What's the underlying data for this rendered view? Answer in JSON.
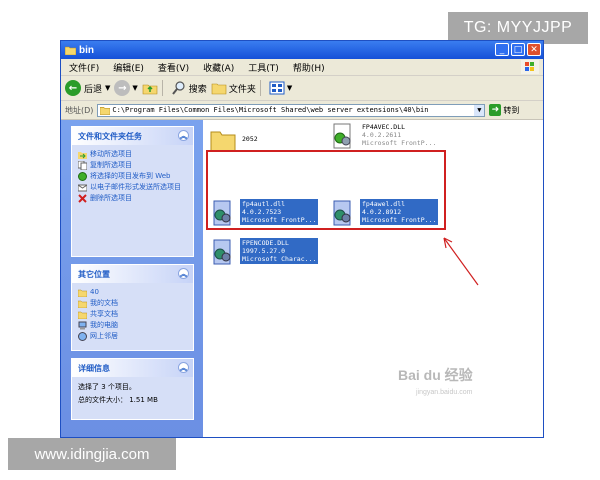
{
  "watermark_top": "TG: MYYJJPP",
  "watermark_bottom": "www.idingjia.com",
  "window": {
    "title": "bin",
    "menu": [
      "文件(F)",
      "编辑(E)",
      "查看(V)",
      "收藏(A)",
      "工具(T)",
      "帮助(H)"
    ],
    "toolbar": {
      "back": "后退",
      "search": "搜索",
      "folders": "文件夹"
    },
    "address": {
      "label": "地址(D)",
      "path": "C:\\Program Files\\Common Files\\Microsoft Shared\\web server extensions\\40\\bin",
      "go": "转到"
    }
  },
  "left_panel": {
    "tasks": {
      "header": "文件和文件夹任务",
      "items": [
        "移动所选项目",
        "复制所选项目",
        "将选择的项目发布到 Web",
        "以电子邮件形式发送所选项目",
        "删除所选项目"
      ]
    },
    "places": {
      "header": "其它位置",
      "items": [
        "40",
        "我的文档",
        "共享文档",
        "我的电脑",
        "网上邻居"
      ]
    },
    "details": {
      "header": "详细信息",
      "line1": "选择了 3 个项目。",
      "line2": "总的文件大小： 1.51 MB"
    }
  },
  "files": [
    {
      "name": "2052",
      "type": "folder",
      "selected": false
    },
    {
      "name": "FP4AVEC.DLL",
      "version": "4.0.2.2611",
      "company": "Microsoft FrontP...",
      "selected": false
    },
    {
      "name": "fp4autl.dll",
      "version": "4.0.2.7523",
      "company": "Microsoft FrontP...",
      "selected": true
    },
    {
      "name": "fp4awel.dll",
      "version": "4.0.2.8912",
      "company": "Microsoft FrontP...",
      "selected": true
    },
    {
      "name": "FPENCODE.DLL",
      "version": "1997.5.27.0",
      "company": "Microsoft Charac...",
      "selected": true
    }
  ],
  "baidu_watermark": {
    "main": "Bai du 经验",
    "sub": "jingyan.baidu.com"
  },
  "colors": {
    "titlebar": "#1550d8",
    "selection": "#316ac5",
    "highlight_box": "#d02020",
    "left_panel": "#6b8fe3"
  }
}
